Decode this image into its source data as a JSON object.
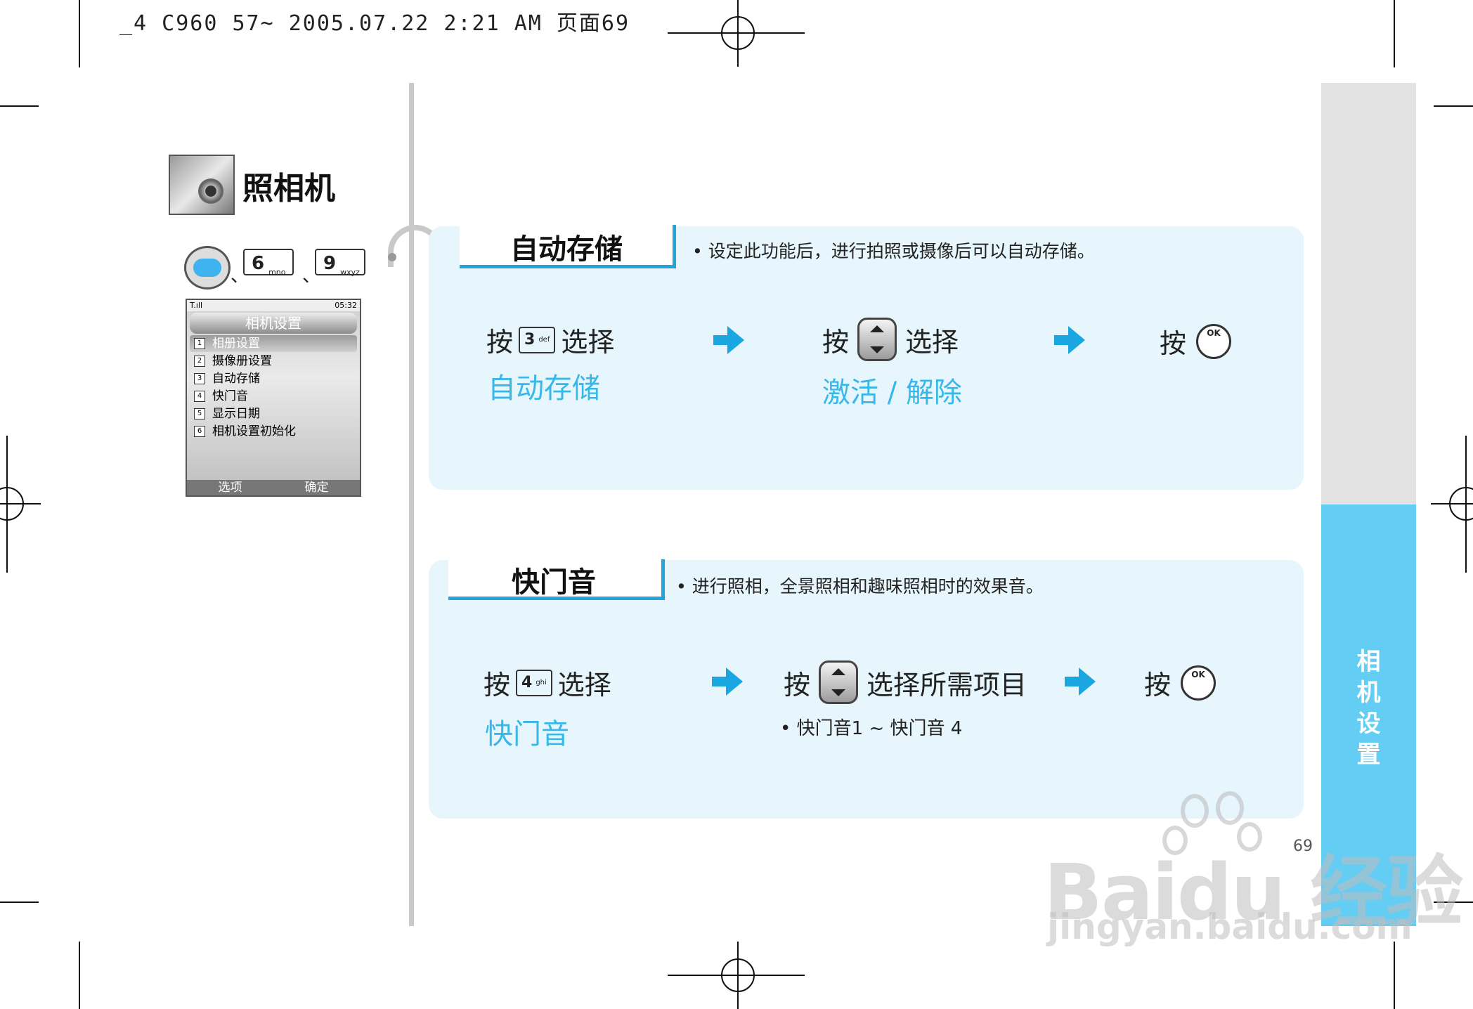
{
  "header_line": "_4 C960 57~ 2005.07.22 2:21 AM 页面69",
  "chapter": {
    "title": "照相机",
    "icon": "camera-icon"
  },
  "key_sequence": {
    "menu_key": "menu-key",
    "separator": "、",
    "keys": [
      {
        "digit": "6",
        "letters": "mno"
      },
      {
        "digit": "9",
        "letters": "wxyz"
      }
    ]
  },
  "phone_screen": {
    "status_left": "T.ıll",
    "status_right": "05:32",
    "title": "相机设置",
    "items": [
      {
        "num": "1",
        "label": "相册设置"
      },
      {
        "num": "2",
        "label": "摄像册设置"
      },
      {
        "num": "3",
        "label": "自动存储"
      },
      {
        "num": "4",
        "label": "快门音"
      },
      {
        "num": "5",
        "label": "显示日期"
      },
      {
        "num": "6",
        "label": "相机设置初始化"
      }
    ],
    "soft_left": "选项",
    "soft_right": "确定"
  },
  "section1": {
    "title": "自动存储",
    "desc": "• 设定此功能后，进行拍照或摄像后可以自动存储。",
    "step1_press": "按",
    "step1_key_digit": "3",
    "step1_key_letters": "def",
    "step1_select": "选择",
    "step1_result": "自动存储",
    "step2_press": "按",
    "step2_select": "选择",
    "step2_result": "激活 / 解除",
    "step3_press": "按",
    "ok_label": "OK"
  },
  "section2": {
    "title": "快门音",
    "desc": "• 进行照相，全景照相和趣味照相时的效果音。",
    "step1_press": "按",
    "step1_key_digit": "4",
    "step1_key_letters": "ghi",
    "step1_select": "选择",
    "step1_result": "快门音",
    "step2_press": "按",
    "step2_select": "选择所需项目",
    "step2_note": "• 快门音1 ~ 快门音 4",
    "step3_press": "按",
    "ok_label": "OK"
  },
  "side_tab": {
    "text": [
      "相",
      "机",
      "设",
      "置"
    ]
  },
  "page_number": "69",
  "watermark": {
    "line1": "Baidu 经验",
    "line2": "jingyan.baidu.com"
  },
  "colors": {
    "accent": "#27a3dc",
    "panel": "#e6f6fc",
    "tab": "#63cdf4",
    "result_text": "#37b8e8"
  }
}
